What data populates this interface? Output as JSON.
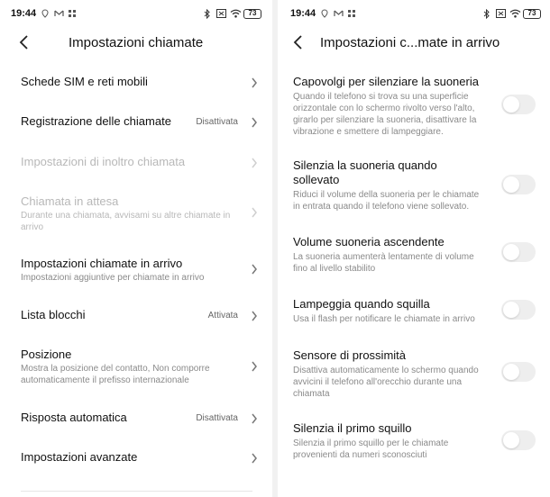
{
  "left": {
    "status": {
      "time": "19:44",
      "battery": "73"
    },
    "header": {
      "title": "Impostazioni chiamate"
    },
    "items": [
      {
        "title": "Schede SIM e reti mobili",
        "subtitle": "",
        "value": ""
      },
      {
        "title": "Registrazione delle chiamate",
        "subtitle": "",
        "value": "Disattivata"
      },
      {
        "title": "Impostazioni di inoltro chiamata",
        "subtitle": "",
        "value": "",
        "disabled": true
      },
      {
        "title": "Chiamata in attesa",
        "subtitle": "Durante una chiamata, avvisami su altre chiamate in arrivo",
        "value": "",
        "disabled": true
      },
      {
        "title": "Impostazioni chiamate in arrivo",
        "subtitle": "Impostazioni aggiuntive per chiamate in arrivo",
        "value": ""
      },
      {
        "title": "Lista blocchi",
        "subtitle": "",
        "value": "Attivata"
      },
      {
        "title": "Posizione",
        "subtitle": "Mostra la posizione del contatto, Non comporre automaticamente il prefisso internazionale",
        "value": ""
      },
      {
        "title": "Risposta automatica",
        "subtitle": "",
        "value": "Disattivata"
      },
      {
        "title": "Impostazioni avanzate",
        "subtitle": "",
        "value": ""
      }
    ]
  },
  "right": {
    "status": {
      "time": "19:44",
      "battery": "73"
    },
    "header": {
      "title": "Impostazioni c...mate in arrivo"
    },
    "items": [
      {
        "title": "Capovolgi per silenziare la suoneria",
        "subtitle": "Quando il telefono si trova su una superficie orizzontale con lo schermo rivolto verso l'alto, girarlo per silenziare la suoneria, disattivare la vibrazione e smettere di lampeggiare.",
        "enabled": false
      },
      {
        "title": "Silenzia la suoneria quando sollevato",
        "subtitle": "Riduci il volume della suoneria per le chiamate in entrata quando il telefono viene sollevato.",
        "enabled": false
      },
      {
        "title": "Volume suoneria ascendente",
        "subtitle": "La suoneria aumenterà lentamente di volume fino al livello stabilito",
        "enabled": false
      },
      {
        "title": "Lampeggia quando squilla",
        "subtitle": "Usa il flash per notificare le chiamate in arrivo",
        "enabled": false
      },
      {
        "title": "Sensore di prossimità",
        "subtitle": "Disattiva automaticamente lo schermo quando avvicini il telefono all'orecchio durante una chiamata",
        "enabled": false
      },
      {
        "title": "Silenzia il primo squillo",
        "subtitle": "Silenzia il primo squillo per le chiamate provenienti da numeri sconosciuti",
        "enabled": false
      }
    ]
  }
}
